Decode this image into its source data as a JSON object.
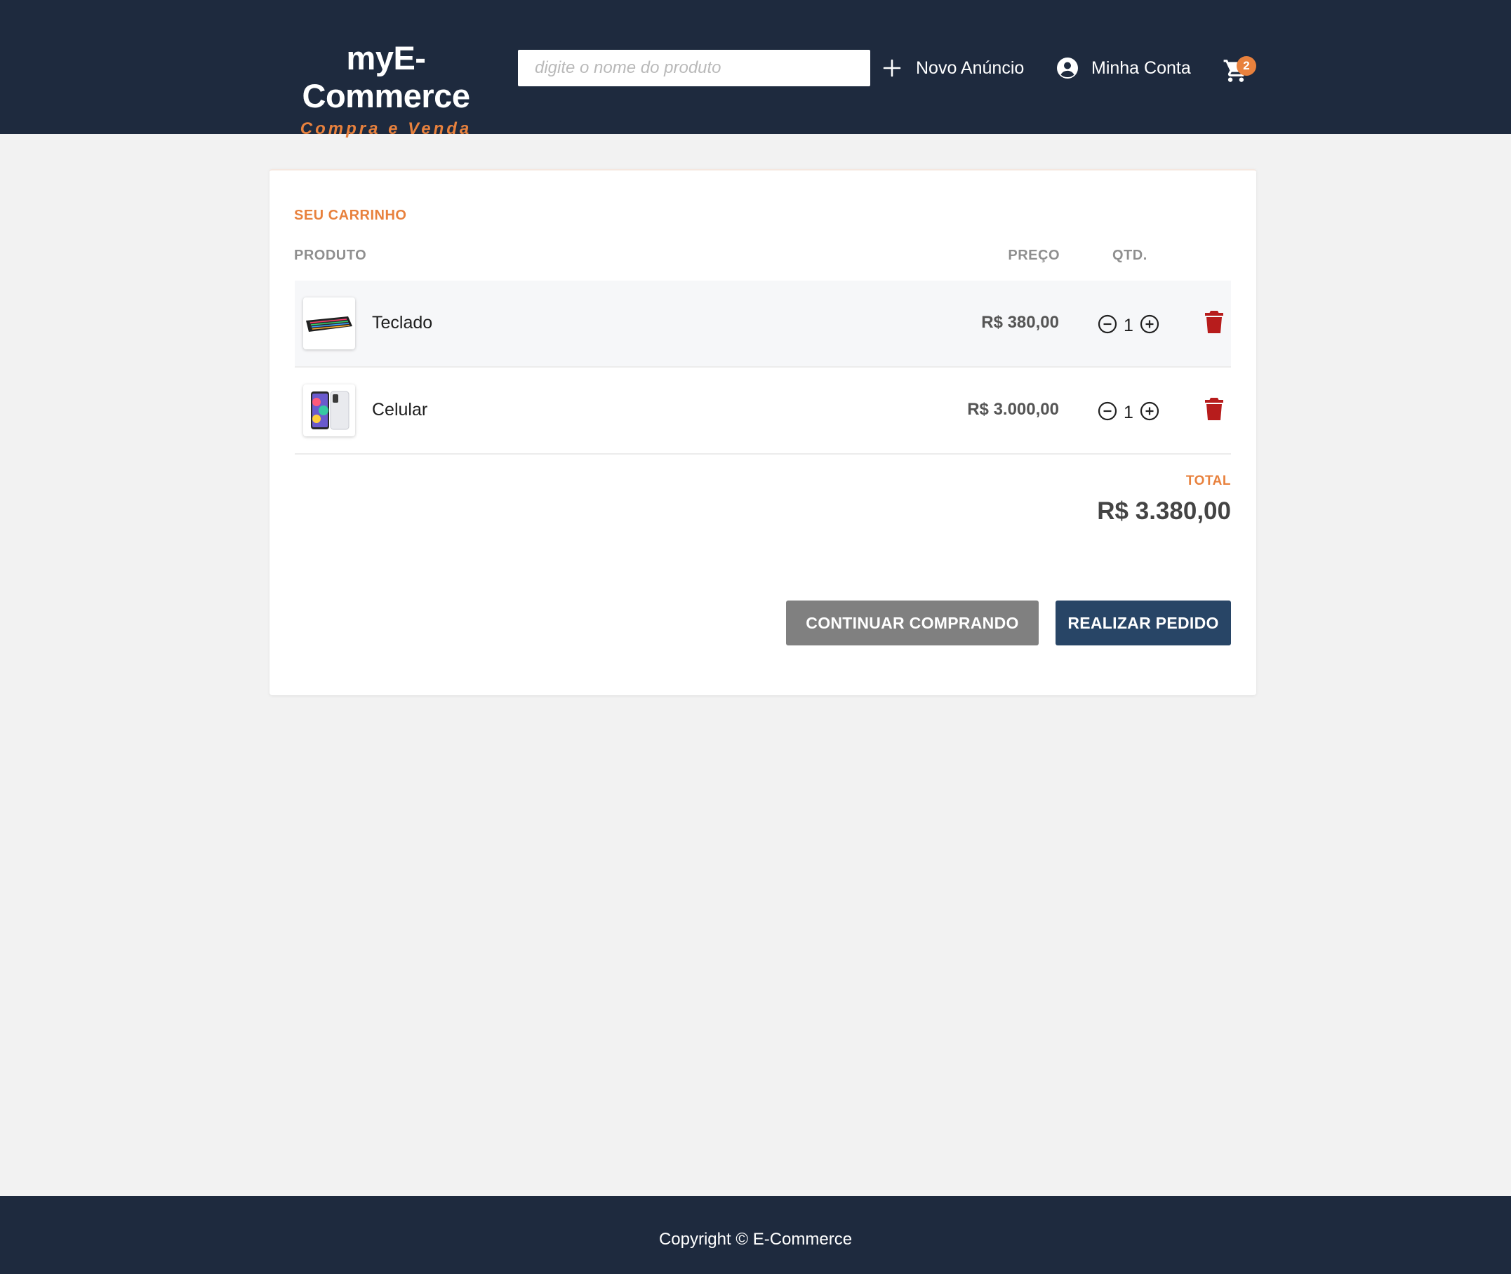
{
  "header": {
    "brand_title": "myE-Commerce",
    "brand_subtitle": "Compra e Venda",
    "search_placeholder": "digite o nome do produto",
    "new_listing_label": "Novo Anúncio",
    "account_label": "Minha Conta",
    "cart_count": "2",
    "icons": {
      "new_listing": "plus-icon",
      "account": "account-circle-icon",
      "cart": "cart-icon"
    }
  },
  "cart": {
    "title": "SEU CARRINHO",
    "columns": {
      "product": "PRODUTO",
      "price": "PREÇO",
      "qty": "QTD."
    },
    "items": [
      {
        "name": "Teclado",
        "price": "R$ 380,00",
        "qty": "1",
        "image": "keyboard-thumbnail"
      },
      {
        "name": "Celular",
        "price": "R$ 3.000,00",
        "qty": "1",
        "image": "phone-thumbnail"
      }
    ],
    "total_label": "TOTAL",
    "total_value": "R$ 3.380,00",
    "continue_label": "CONTINUAR COMPRANDO",
    "order_label": "REALIZAR PEDIDO"
  },
  "footer": {
    "copyright": "Copyright © E-Commerce"
  },
  "colors": {
    "navbar": "#1e2a3e",
    "accent": "#e8813d",
    "primary_button": "#284566",
    "secondary_button": "#808080",
    "delete": "#b71c1c",
    "background": "#f2f2f2"
  }
}
